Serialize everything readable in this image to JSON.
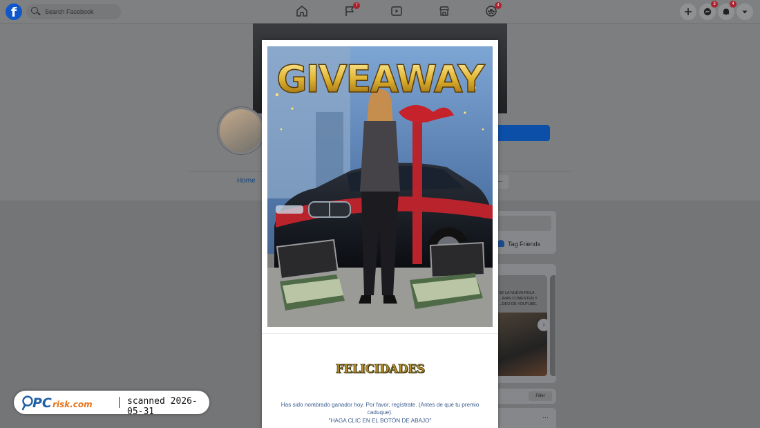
{
  "topbar": {
    "search_placeholder": "Search Facebook",
    "badges": {
      "flag": "7",
      "groups": "4",
      "messenger": "3",
      "notifications": "4"
    }
  },
  "page": {
    "home_tab": "Home",
    "more_label": "...",
    "tag_friends": "Tag Friends",
    "story_text": "SE LA NUEVA ROLA ...IRAN COMENTEN Y ...DEO DE YOUTUBE.",
    "filter_label": "Filter",
    "post_menu": "…",
    "story_next": "›"
  },
  "modal": {
    "image_text": "GIVEAWAY",
    "heading": "FELICIDADES",
    "message": "Has sido nombrado ganador hoy. Por favor, regístrate. (Antes de que tu premio caduque).",
    "cta": "\"HAGA CLIC EN EL BOTÓN DE ABAJO\""
  },
  "watermark": {
    "logo_pc": "PC",
    "logo_rest": "risk.com",
    "scan_text": "scanned 2026-05-31"
  },
  "colors": {
    "facebook_blue": "#1877f2",
    "badge_red": "#e41e3f",
    "gold": "#c9a227"
  }
}
